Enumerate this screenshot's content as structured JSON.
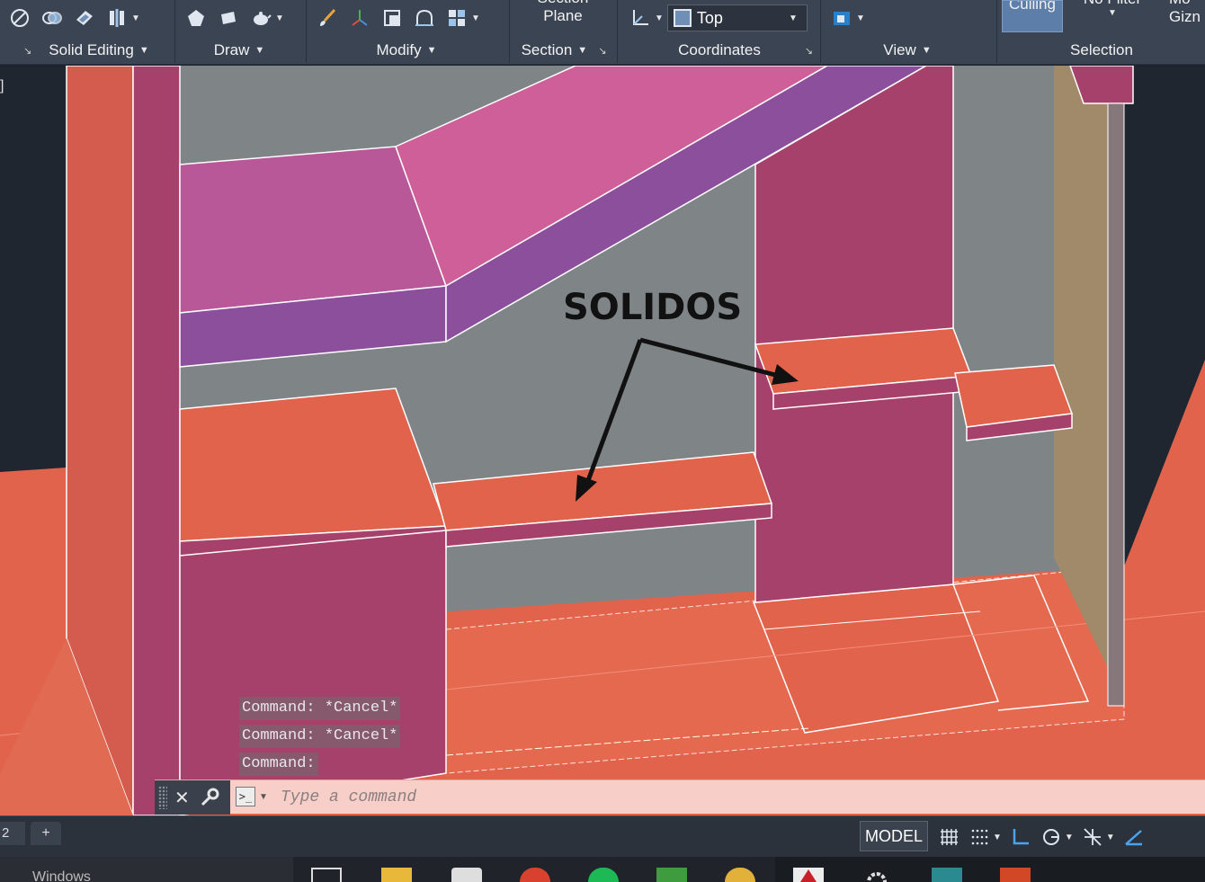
{
  "ribbon": {
    "panels": [
      {
        "label": "Solid Editing"
      },
      {
        "label": "Draw"
      },
      {
        "label": "Modify"
      },
      {
        "label": "Section"
      },
      {
        "label": "Coordinates"
      },
      {
        "label": "View"
      },
      {
        "label": "Selection"
      }
    ],
    "section_plane_label_top": "Section",
    "section_plane_label": "Plane",
    "view_combo_value": "Top",
    "culling_label": "Culling",
    "no_filter_label": "No Filter",
    "gizmo_label_top": "Mo",
    "gizmo_label": "Gizn"
  },
  "viewport": {
    "corner_label": "]",
    "annotation_text": "SOLIDOS",
    "colors": {
      "floor": "#e2634b",
      "wall_gray": "#7f8587",
      "pillar": "#a5416a",
      "beam_pink": "#c85b98",
      "beam_purple": "#8b4f9b",
      "tan": "#a08a6a",
      "background": "#1f2630"
    }
  },
  "command": {
    "history": [
      "Command: *Cancel*",
      "Command: *Cancel*",
      "Command:"
    ],
    "placeholder": "Type a command"
  },
  "status": {
    "layout_tab": "2",
    "model_label": "MODEL"
  },
  "taskbar": {
    "search_text": "Windows"
  }
}
